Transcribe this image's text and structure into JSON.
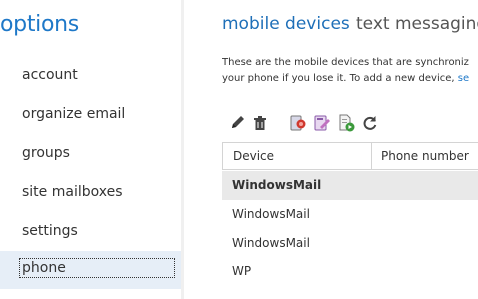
{
  "sidebar": {
    "title": "options",
    "items": [
      {
        "label": "account"
      },
      {
        "label": "organize email"
      },
      {
        "label": "groups"
      },
      {
        "label": "site mailboxes"
      },
      {
        "label": "settings"
      },
      {
        "label": "phone"
      }
    ],
    "selected": "phone"
  },
  "tabs": [
    {
      "label": "mobile devices",
      "active": true
    },
    {
      "label": "text messaging",
      "active": false
    }
  ],
  "description": {
    "line1": "These are the mobile devices that are synchroniz",
    "line2": "your phone if you lose it. To add a new device, ",
    "link_fragment": "se"
  },
  "toolbar": {
    "buttons": [
      "edit-icon",
      "delete-icon",
      "block-icon",
      "wipe-icon",
      "export-log-icon",
      "refresh-icon"
    ]
  },
  "table": {
    "headers": [
      "Device",
      "Phone number"
    ],
    "rows": [
      {
        "device": "WindowsMail",
        "phone": "",
        "selected": true
      },
      {
        "device": "WindowsMail",
        "phone": "",
        "selected": false
      },
      {
        "device": "WindowsMail",
        "phone": "",
        "selected": false
      },
      {
        "device": "WP",
        "phone": "",
        "selected": false
      }
    ]
  },
  "colors": {
    "accent": "#1e78c8",
    "selected_nav_bg": "#e6eef7",
    "selected_row_bg": "#e9e9e9"
  }
}
